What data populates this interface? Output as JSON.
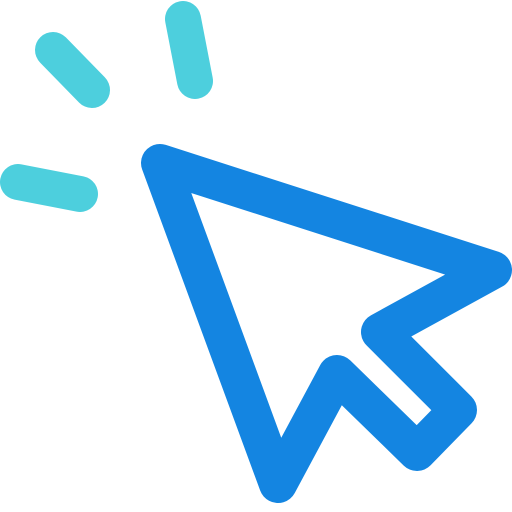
{
  "icon": {
    "name": "cursor-click-icon",
    "colors": {
      "pointer": "#1485E1",
      "click_rays": "#4DCFDD",
      "background": "#FFFFFF"
    },
    "parts": [
      "pointer-arrow",
      "click-ray-top",
      "click-ray-upper-left",
      "click-ray-left"
    ]
  }
}
